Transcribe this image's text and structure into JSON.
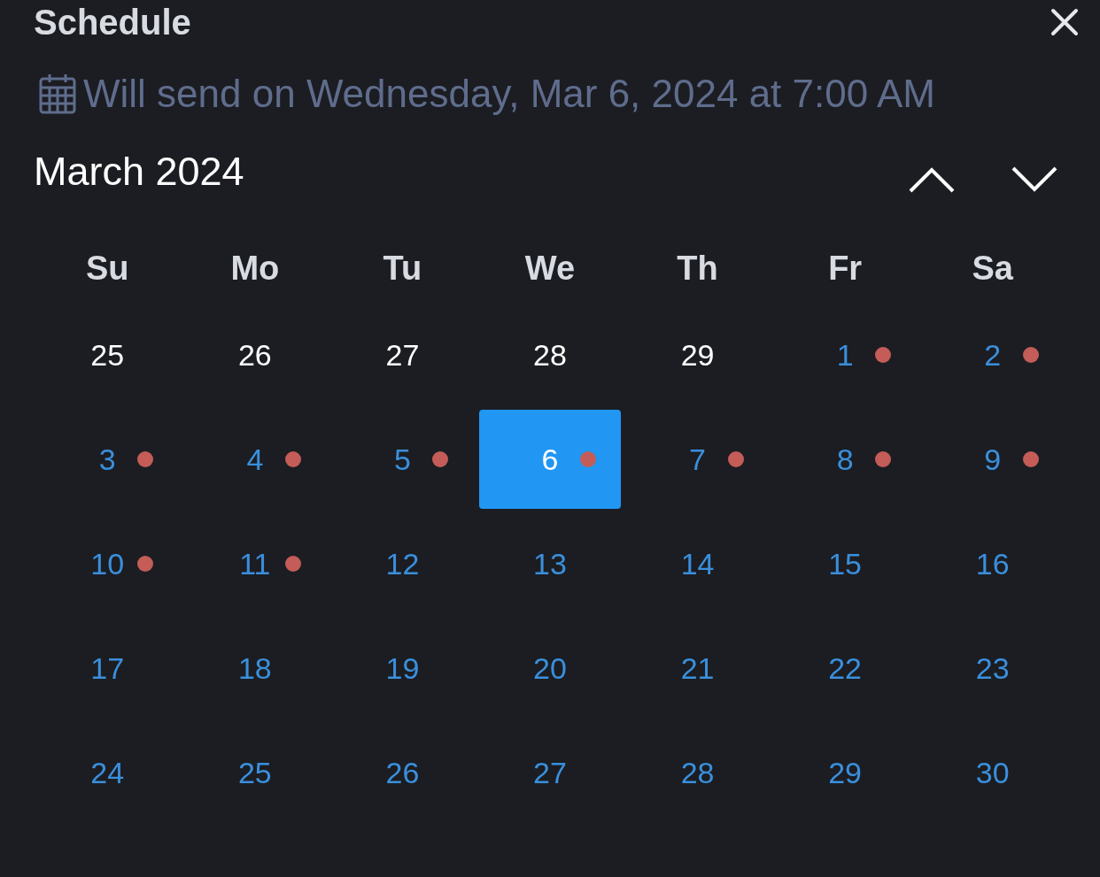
{
  "title": "Schedule",
  "send_info": "Will send on Wednesday, Mar 6, 2024 at 7:00 AM",
  "month_label": "March 2024",
  "weekdays": [
    "Su",
    "Mo",
    "Tu",
    "We",
    "Th",
    "Fr",
    "Sa"
  ],
  "days": [
    {
      "label": "25",
      "in_month": false,
      "has_event": false,
      "selected": false
    },
    {
      "label": "26",
      "in_month": false,
      "has_event": false,
      "selected": false
    },
    {
      "label": "27",
      "in_month": false,
      "has_event": false,
      "selected": false
    },
    {
      "label": "28",
      "in_month": false,
      "has_event": false,
      "selected": false
    },
    {
      "label": "29",
      "in_month": false,
      "has_event": false,
      "selected": false
    },
    {
      "label": "1",
      "in_month": true,
      "has_event": true,
      "selected": false
    },
    {
      "label": "2",
      "in_month": true,
      "has_event": true,
      "selected": false
    },
    {
      "label": "3",
      "in_month": true,
      "has_event": true,
      "selected": false
    },
    {
      "label": "4",
      "in_month": true,
      "has_event": true,
      "selected": false
    },
    {
      "label": "5",
      "in_month": true,
      "has_event": true,
      "selected": false
    },
    {
      "label": "6",
      "in_month": true,
      "has_event": true,
      "selected": true
    },
    {
      "label": "7",
      "in_month": true,
      "has_event": true,
      "selected": false
    },
    {
      "label": "8",
      "in_month": true,
      "has_event": true,
      "selected": false
    },
    {
      "label": "9",
      "in_month": true,
      "has_event": true,
      "selected": false
    },
    {
      "label": "10",
      "in_month": true,
      "has_event": true,
      "selected": false
    },
    {
      "label": "11",
      "in_month": true,
      "has_event": true,
      "selected": false
    },
    {
      "label": "12",
      "in_month": true,
      "has_event": false,
      "selected": false
    },
    {
      "label": "13",
      "in_month": true,
      "has_event": false,
      "selected": false
    },
    {
      "label": "14",
      "in_month": true,
      "has_event": false,
      "selected": false
    },
    {
      "label": "15",
      "in_month": true,
      "has_event": false,
      "selected": false
    },
    {
      "label": "16",
      "in_month": true,
      "has_event": false,
      "selected": false
    },
    {
      "label": "17",
      "in_month": true,
      "has_event": false,
      "selected": false
    },
    {
      "label": "18",
      "in_month": true,
      "has_event": false,
      "selected": false
    },
    {
      "label": "19",
      "in_month": true,
      "has_event": false,
      "selected": false
    },
    {
      "label": "20",
      "in_month": true,
      "has_event": false,
      "selected": false
    },
    {
      "label": "21",
      "in_month": true,
      "has_event": false,
      "selected": false
    },
    {
      "label": "22",
      "in_month": true,
      "has_event": false,
      "selected": false
    },
    {
      "label": "23",
      "in_month": true,
      "has_event": false,
      "selected": false
    },
    {
      "label": "24",
      "in_month": true,
      "has_event": false,
      "selected": false
    },
    {
      "label": "25",
      "in_month": true,
      "has_event": false,
      "selected": false
    },
    {
      "label": "26",
      "in_month": true,
      "has_event": false,
      "selected": false
    },
    {
      "label": "27",
      "in_month": true,
      "has_event": false,
      "selected": false
    },
    {
      "label": "28",
      "in_month": true,
      "has_event": false,
      "selected": false
    },
    {
      "label": "29",
      "in_month": true,
      "has_event": false,
      "selected": false
    },
    {
      "label": "30",
      "in_month": true,
      "has_event": false,
      "selected": false
    }
  ]
}
